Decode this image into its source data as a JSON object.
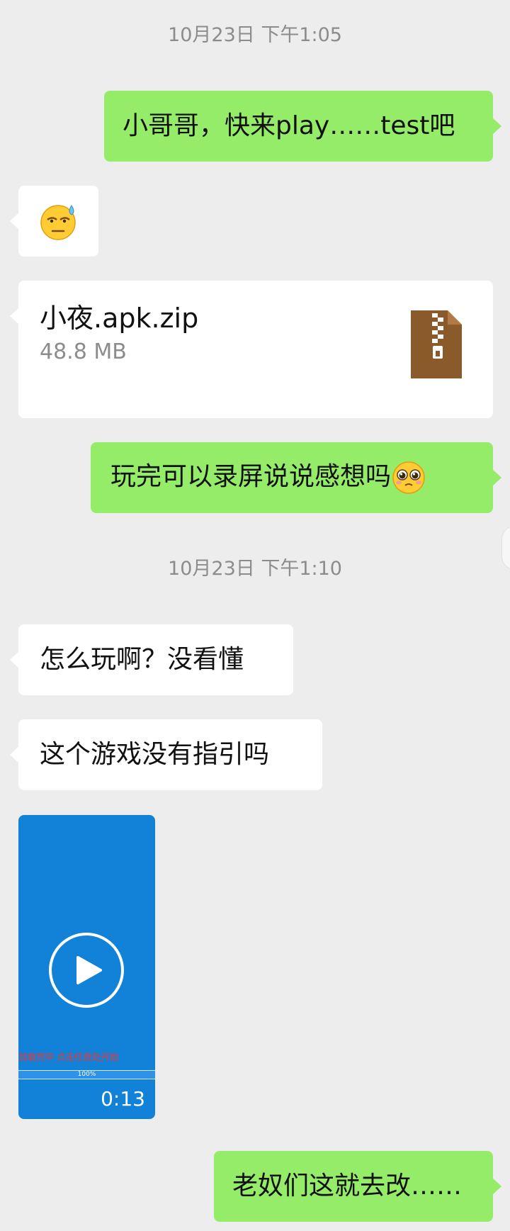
{
  "timestamps": [
    "10月23日 下午1:05",
    "10月23日 下午1:10"
  ],
  "messages": {
    "m1": "小哥哥，快来play……test吧",
    "m2_emoji": "sweat-grimace-emoji",
    "m3_file": {
      "name": "小夜.apk.zip",
      "size": "48.8  MB",
      "icon": "zip-file-icon"
    },
    "m4": "玩完可以录屏说说感想吗",
    "m4_emoji": "pleading-face-emoji",
    "m5": "怎么玩啊？没看懂",
    "m6": "这个游戏没有指引吗",
    "m7_video": {
      "caption": "加载完毕    点击任意处开始",
      "progress_label": "100%",
      "progress": 1.0,
      "duration": "0:13",
      "icon": "play-icon"
    },
    "m8": "老奴们这就去改……"
  },
  "colors": {
    "background": "#ededed",
    "self_bubble": "#95ec69",
    "other_bubble": "#ffffff",
    "timestamp": "#8c8c8c",
    "video_bg": "#1281d8",
    "zip_icon": "#8b5a2b"
  }
}
